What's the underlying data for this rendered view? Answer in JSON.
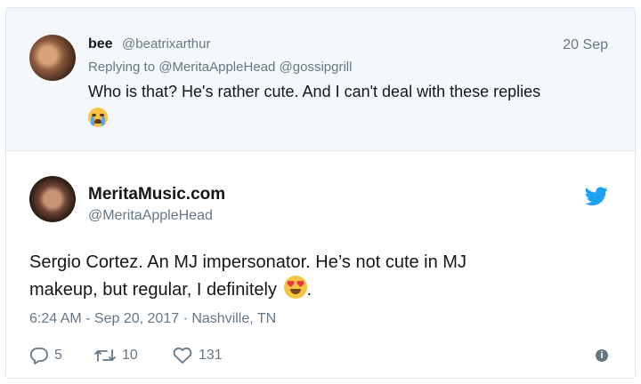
{
  "parent_tweet": {
    "name": "bee",
    "handle": "@beatrixarthur",
    "date": "20 Sep",
    "replying_prefix": "Replying to",
    "reply_to": [
      "@MeritaAppleHead",
      "@gossipgrill"
    ],
    "text": "Who is that? He's rather cute. And I can't deal with these replies",
    "emoji": "crying-face"
  },
  "tweet": {
    "name": "MeritaMusic.com",
    "handle": "@MeritaAppleHead",
    "text_line1": "Sergio Cortez. An MJ impersonator. He’s not cute in MJ",
    "text_line2": "makeup, but regular, I definitely",
    "text_end": ".",
    "emoji": "heart-eyes-face",
    "meta": "6:24 AM - Sep 20, 2017 · Nashville, TN",
    "replies": "5",
    "retweets": "10",
    "likes": "131"
  },
  "colors": {
    "accent": "#1da1f2",
    "muted": "#657786",
    "text": "#14171a",
    "parent_bg": "#f5f8fa"
  }
}
